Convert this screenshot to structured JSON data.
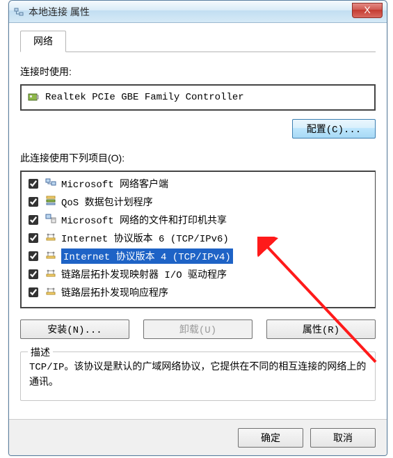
{
  "window": {
    "title": "本地连接 属性",
    "close_glyph": "X"
  },
  "tab": {
    "label": "网络"
  },
  "connect_using_label": "连接时使用:",
  "adapter": {
    "name": "Realtek PCIe GBE Family Controller"
  },
  "configure_btn": "配置(C)...",
  "items_label": "此连接使用下列项目(O):",
  "items": [
    {
      "label": "Microsoft 网络客户端",
      "checked": true,
      "icon": "client"
    },
    {
      "label": "QoS 数据包计划程序",
      "checked": true,
      "icon": "qos"
    },
    {
      "label": "Microsoft 网络的文件和打印机共享",
      "checked": true,
      "icon": "share"
    },
    {
      "label": "Internet 协议版本 6 (TCP/IPv6)",
      "checked": true,
      "icon": "proto"
    },
    {
      "label": "Internet 协议版本 4 (TCP/IPv4)",
      "checked": true,
      "icon": "proto",
      "selected": true
    },
    {
      "label": "链路层拓扑发现映射器 I/O 驱动程序",
      "checked": true,
      "icon": "proto"
    },
    {
      "label": "链路层拓扑发现响应程序",
      "checked": true,
      "icon": "proto"
    }
  ],
  "buttons": {
    "install": "安装(N)...",
    "uninstall": "卸载(U)",
    "properties": "属性(R)"
  },
  "description": {
    "legend": "描述",
    "text": "TCP/IP。该协议是默认的广域网络协议，它提供在不同的相互连接的网络上的通讯。"
  },
  "footer": {
    "ok": "确定",
    "cancel": "取消"
  }
}
